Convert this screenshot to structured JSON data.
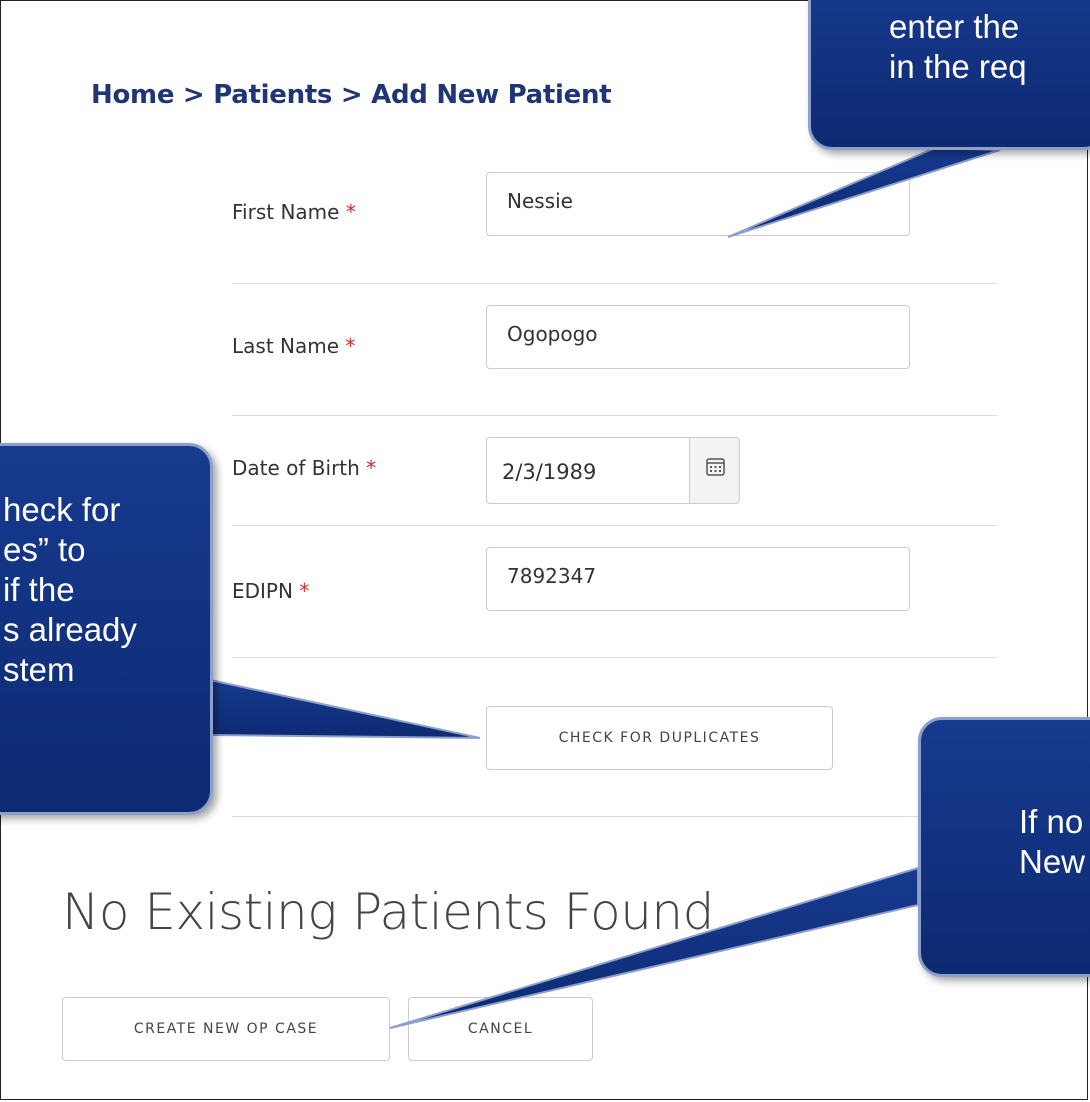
{
  "breadcrumb": {
    "home": "Home",
    "patients": "Patients",
    "current": "Add New Patient",
    "separator": ">"
  },
  "form": {
    "required_marker": "*",
    "first_name": {
      "label": "First Name",
      "value": "Nessie"
    },
    "last_name": {
      "label": "Last Name",
      "value": "Ogopogo"
    },
    "dob": {
      "label": "Date of Birth",
      "value": "2/3/1989",
      "icon": "calendar-icon"
    },
    "edipn": {
      "label": "EDIPN",
      "value": "7892347"
    },
    "check_duplicates_label": "CHECK FOR DUPLICATES"
  },
  "result": {
    "heading": "No Existing Patients Found"
  },
  "actions": {
    "create_label": "CREATE NEW OP CASE",
    "cancel_label": "CANCEL"
  },
  "callouts": {
    "top_line1": "enter the",
    "top_line2": "in the req",
    "left_line1": "heck for",
    "left_line2": "es” to",
    "left_line3": " if the",
    "left_line4": "s already",
    "left_line5": "stem",
    "right_line1": "If no",
    "right_line2": "New"
  },
  "colors": {
    "breadcrumb": "#1f3576",
    "required": "#d62828",
    "callout_fill": "#173a8f",
    "callout_border": "#8ea0c9"
  }
}
